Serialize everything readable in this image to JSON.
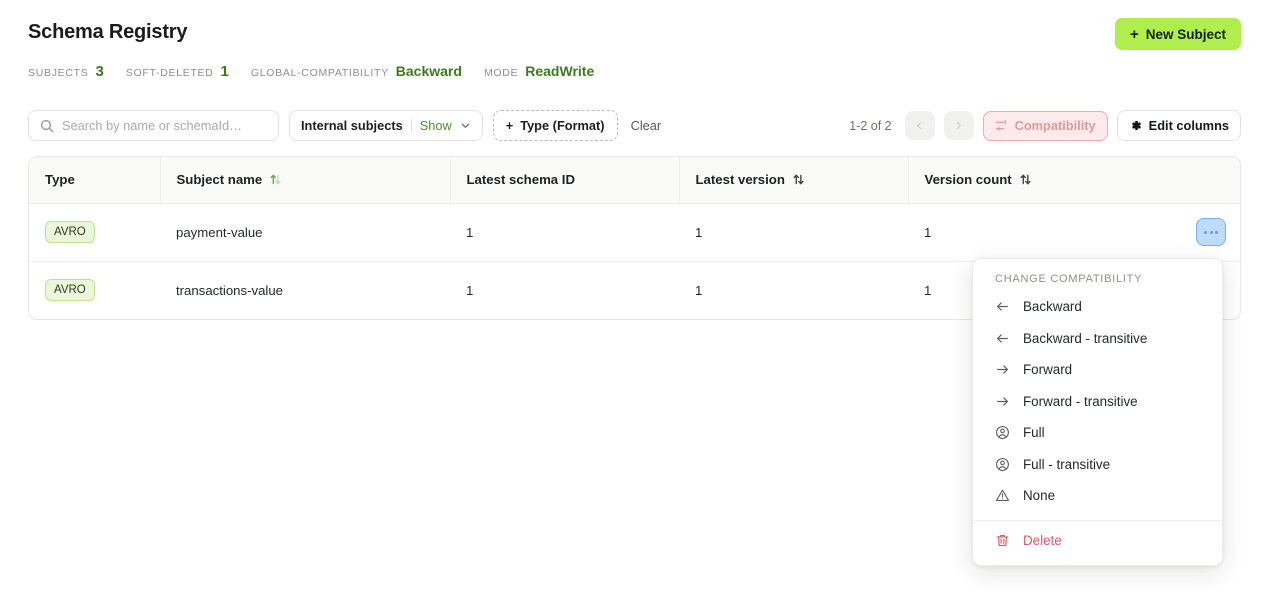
{
  "header": {
    "title": "Schema Registry",
    "new_subject_label": "New Subject",
    "plus": "+",
    "stats": [
      {
        "label": "SUBJECTS",
        "value": "3"
      },
      {
        "label": "SOFT-DELETED",
        "value": "1"
      },
      {
        "label": "GLOBAL-COMPATIBILITY",
        "value": "Backward"
      },
      {
        "label": "MODE",
        "value": "ReadWrite"
      }
    ]
  },
  "toolbar": {
    "search_placeholder": "Search by name or schemaId…",
    "search_value": "",
    "internal_subjects_label": "Internal subjects",
    "internal_subjects_state": "Show",
    "type_filter_label": "Type (Format)",
    "type_filter_plus": "+",
    "clear_label": "Clear",
    "range_label": "1-2 of 2",
    "compatibility_label": "Compatibility",
    "edit_columns_label": "Edit columns"
  },
  "table": {
    "columns": [
      {
        "label": "Type",
        "sortable": false
      },
      {
        "label": "Subject name",
        "sortable": true,
        "sorted": "asc"
      },
      {
        "label": "Latest schema ID",
        "sortable": false
      },
      {
        "label": "Latest version",
        "sortable": true,
        "sorted": "none"
      },
      {
        "label": "Version count",
        "sortable": true,
        "sorted": "none"
      }
    ],
    "rows": [
      {
        "type": "AVRO",
        "subject_name": "payment-value",
        "latest_schema_id": "1",
        "latest_version": "1",
        "version_count": "1"
      },
      {
        "type": "AVRO",
        "subject_name": "transactions-value",
        "latest_schema_id": "1",
        "latest_version": "1",
        "version_count": "1"
      }
    ]
  },
  "menu": {
    "title": "CHANGE COMPATIBILITY",
    "items": [
      {
        "label": "Backward",
        "icon": "arrow-left-icon"
      },
      {
        "label": "Backward - transitive",
        "icon": "arrow-left-icon"
      },
      {
        "label": "Forward",
        "icon": "arrow-right-icon"
      },
      {
        "label": "Forward - transitive",
        "icon": "arrow-right-icon"
      },
      {
        "label": "Full",
        "icon": "user-circle-icon"
      },
      {
        "label": "Full - transitive",
        "icon": "user-circle-icon"
      },
      {
        "label": "None",
        "icon": "warning-triangle-icon"
      }
    ],
    "delete_label": "Delete"
  },
  "colors": {
    "accent_green": "#b0ee4d",
    "value_green": "#3d7a1f",
    "danger": "#e4546a",
    "compat_pink_border": "#f4a9ab",
    "compat_pink_bg": "#fdeaea",
    "badge_bg": "#eaf7d8",
    "badge_border": "#bfe38d",
    "kebab_active_bg": "#bedcfa",
    "kebab_active_border": "#74b0e8"
  }
}
